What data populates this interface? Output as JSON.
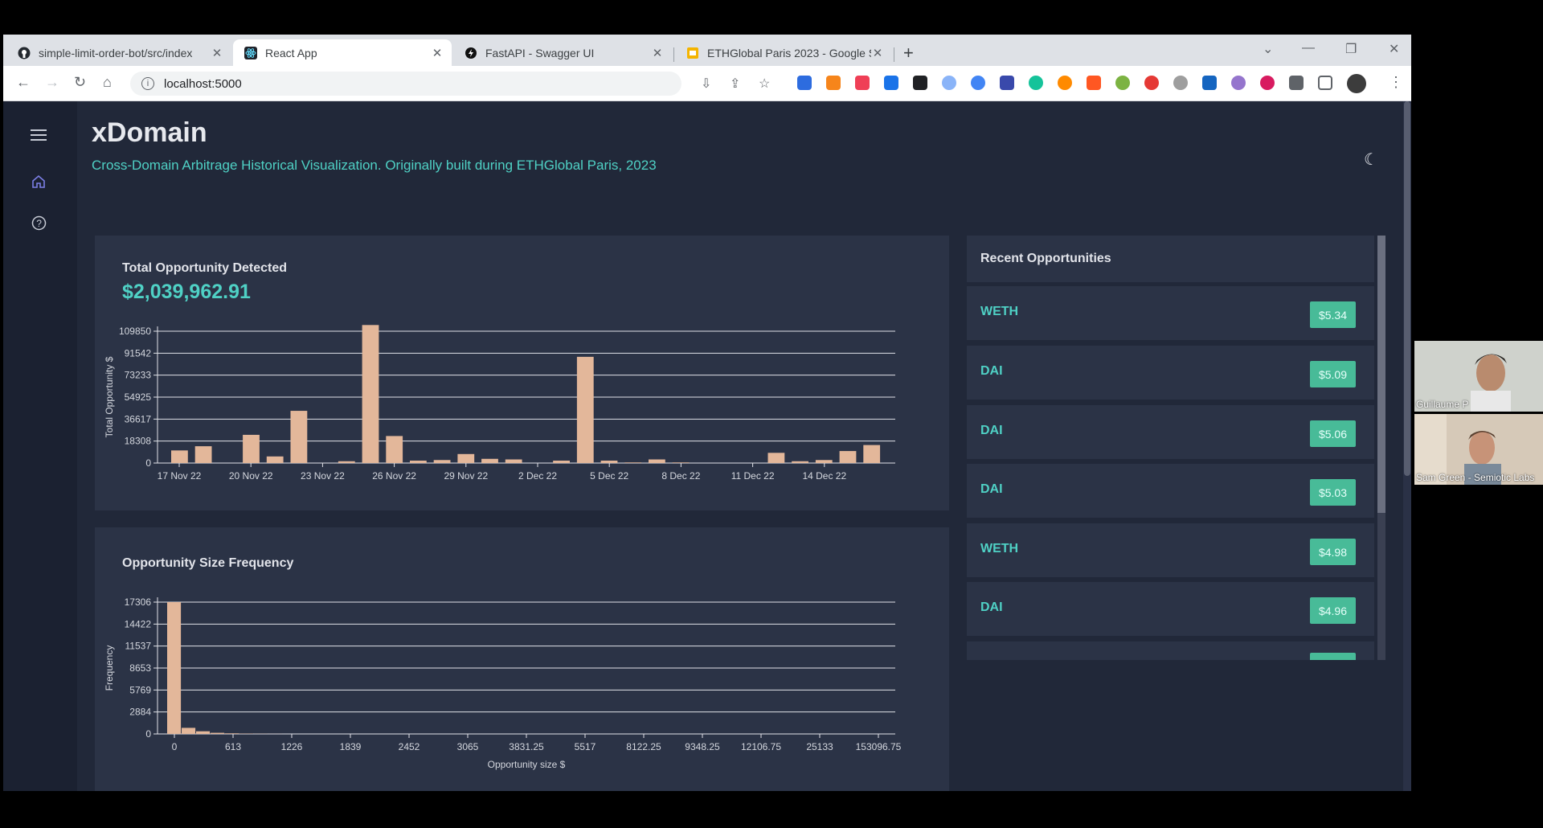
{
  "browser": {
    "tabs": [
      {
        "title": "simple-limit-order-bot/src/index",
        "icon": "github-icon"
      },
      {
        "title": "React App",
        "icon": "react-icon",
        "active": true
      },
      {
        "title": "FastAPI - Swagger UI",
        "icon": "fastapi-icon"
      },
      {
        "title": "ETHGlobal Paris 2023 - Google S",
        "icon": "google-slides-icon"
      }
    ],
    "url": "localhost:5000"
  },
  "app": {
    "title": "xDomain",
    "subtitle": "Cross-Domain Arbitrage Historical Visualization. Originally built during ETHGlobal Paris, 2023"
  },
  "total_card": {
    "title": "Total Opportunity Detected",
    "amount": "$2,039,962.91"
  },
  "frequency_card": {
    "title": "Opportunity Size Frequency"
  },
  "recent": {
    "title": "Recent Opportunities",
    "items": [
      {
        "token": "WETH",
        "value": "$5.34"
      },
      {
        "token": "DAI",
        "value": "$5.09"
      },
      {
        "token": "DAI",
        "value": "$5.06"
      },
      {
        "token": "DAI",
        "value": "$5.03"
      },
      {
        "token": "WETH",
        "value": "$4.98"
      },
      {
        "token": "DAI",
        "value": "$4.96"
      }
    ]
  },
  "participants": [
    {
      "name": "Guillaume P"
    },
    {
      "name": "Sam Green - Semiotic Labs"
    }
  ],
  "colors": {
    "accent": "#4fd1c5",
    "bar": "#e3b79a",
    "badge": "#48bb98",
    "background": "#212839",
    "card": "#2b3346"
  },
  "chart_data": [
    {
      "type": "bar",
      "title": "Total Opportunity Detected",
      "ylabel": "Total Opportunity $",
      "xlabel": "",
      "ylim": [
        0,
        109850
      ],
      "yticks": [
        0,
        18308,
        36617,
        54925,
        73233,
        91542,
        109850
      ],
      "xticks": [
        "17 Nov 22",
        "20 Nov 22",
        "23 Nov 22",
        "26 Nov 22",
        "29 Nov 22",
        "2 Dec 22",
        "5 Dec 22",
        "8 Dec 22",
        "11 Dec 22",
        "14 Dec 22"
      ],
      "categories": [
        "17 Nov 22",
        "18 Nov 22",
        "19 Nov 22",
        "20 Nov 22",
        "21 Nov 22",
        "22 Nov 22",
        "23 Nov 22",
        "24 Nov 22",
        "25 Nov 22",
        "26 Nov 22",
        "27 Nov 22",
        "28 Nov 22",
        "29 Nov 22",
        "30 Nov 22",
        "1 Dec 22",
        "2 Dec 22",
        "3 Dec 22",
        "4 Dec 22",
        "5 Dec 22",
        "6 Dec 22",
        "7 Dec 22",
        "8 Dec 22",
        "9 Dec 22",
        "10 Dec 22",
        "11 Dec 22",
        "12 Dec 22",
        "13 Dec 22",
        "14 Dec 22",
        "15 Dec 22",
        "16 Dec 22",
        "17 Dec 22"
      ],
      "values": [
        10500,
        14000,
        0,
        23500,
        5500,
        43500,
        0,
        1500,
        115000,
        22500,
        2000,
        2500,
        7500,
        3500,
        3000,
        0,
        2000,
        88500,
        2000,
        500,
        3000,
        500,
        0,
        0,
        0,
        8500,
        1500,
        2500,
        10000,
        15000,
        0
      ],
      "grid": true
    },
    {
      "type": "bar",
      "title": "Opportunity Size Frequency",
      "ylabel": "Frequency",
      "xlabel": "Opportunity size $",
      "ylim": [
        0,
        17306
      ],
      "yticks": [
        0,
        2884,
        5769,
        8653,
        11537,
        14422,
        17306
      ],
      "xticks": [
        "0",
        "613",
        "1226",
        "1839",
        "2452",
        "3065",
        "3831.25",
        "5517",
        "8122.25",
        "9348.25",
        "12106.75",
        "25133",
        "153096.75"
      ],
      "values": [
        17306,
        800,
        350,
        150,
        80,
        40,
        20,
        10
      ],
      "grid": true
    }
  ]
}
